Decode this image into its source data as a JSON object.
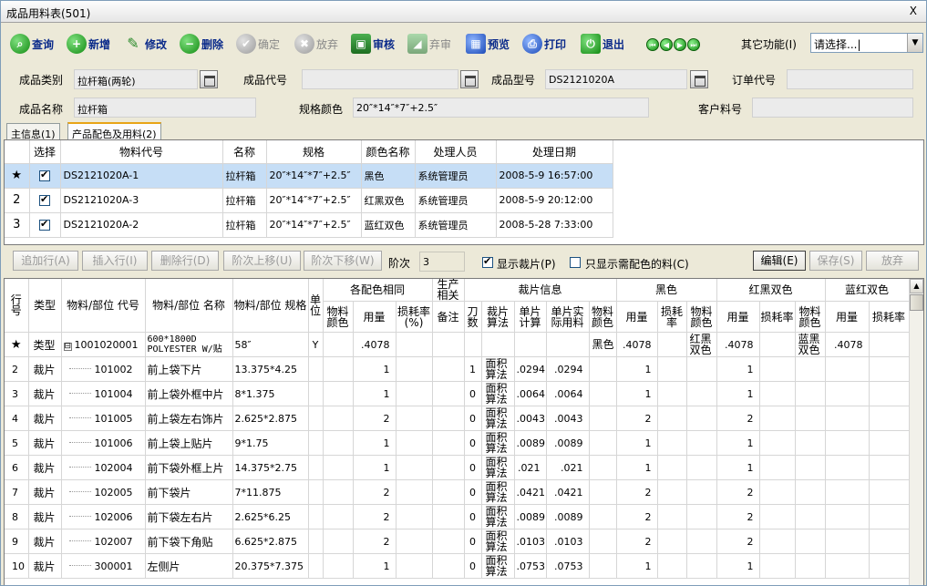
{
  "window": {
    "title": "成品用料表(501)",
    "close": "X"
  },
  "toolbar": {
    "query": "查询",
    "add": "新增",
    "edit": "修改",
    "delete": "删除",
    "confirm": "确定",
    "abandon": "放弃",
    "approve": "审核",
    "unapprove": "弃审",
    "preview": "预览",
    "print": "打印",
    "exit": "退出",
    "other_label": "其它功能(I)",
    "other_value": "请选择...|"
  },
  "header": {
    "category_label": "成品类别",
    "category_value": "拉杆箱(两轮)",
    "code_label": "成品代号",
    "code_value": "",
    "model_label": "成品型号",
    "model_value": "DS2121020A",
    "order_label": "订单代号",
    "order_value": "",
    "name_label": "成品名称",
    "name_value": "拉杆箱",
    "spec_label": "规格颜色",
    "spec_value": "20″*14″*7″+2.5″",
    "customer_label": "客户料号",
    "customer_value": ""
  },
  "tabs": [
    {
      "label": "主信息(1)"
    },
    {
      "label": "产品配色及用料(2)"
    }
  ],
  "color_grid": {
    "headers": [
      "选择",
      "物料代号",
      "名称",
      "规格",
      "颜色名称",
      "处理人员",
      "处理日期"
    ],
    "rows": [
      {
        "marker": "★",
        "checked": true,
        "code": "DS2121020A-1",
        "name": "拉杆箱",
        "spec": "20″*14″*7″+2.5″",
        "color": "黑色",
        "user": "系统管理员",
        "date": "2008-5-9 16:57:00"
      },
      {
        "marker": "2",
        "checked": true,
        "code": "DS2121020A-3",
        "name": "拉杆箱",
        "spec": "20″*14″*7″+2.5″",
        "color": "红黑双色",
        "user": "系统管理员",
        "date": "2008-5-9 20:12:00"
      },
      {
        "marker": "3",
        "checked": true,
        "code": "DS2121020A-2",
        "name": "拉杆箱",
        "spec": "20″*14″*7″+2.5″",
        "color": "蓝红双色",
        "user": "系统管理员",
        "date": "2008-5-28 7:33:00"
      }
    ]
  },
  "actions": {
    "append_row": "追加行(A)",
    "insert_row": "插入行(I)",
    "delete_row": "删除行(D)",
    "move_up": "阶次上移(U)",
    "move_down": "阶次下移(W)",
    "level_label": "阶次",
    "level_value": "3",
    "show_cut_label": "显示裁片(P)",
    "show_cut_checked": true,
    "only_color_label": "只显示需配色的料(C)",
    "only_color_checked": false,
    "edit": "编辑(E)",
    "save": "保存(S)",
    "abandon": "放弃"
  },
  "bom_grid": {
    "headers": {
      "row_no": "行号",
      "type": "类型",
      "part_code": "物料/部位 代号",
      "part_name": "物料/部位 名称",
      "part_spec": "物料/部位 规格",
      "unit": "单位",
      "common_group": "各配色相同",
      "mat_color": "物料颜色",
      "qty": "用量",
      "loss": "损耗率(%)",
      "prod_group": "生产相关",
      "remark": "备注",
      "cut_group": "裁片信息",
      "knife": "刀数",
      "cut_algo": "裁片算法",
      "unit_calc": "单片计算",
      "unit_actual": "单片实际用料",
      "black_group": "黑色",
      "rb_group": "红黑双色",
      "br_group": "蓝红双色",
      "c_mat_color": "物料颜色",
      "c_qty": "用量",
      "c_loss": "损耗率"
    },
    "rows": [
      {
        "no": "★",
        "type": "类型",
        "tree": "⊟",
        "code": "1001020001",
        "name": "600*1800D POLYESTER W/贴",
        "spec": "58″",
        "unit": "Y",
        "qty": ".4078",
        "loss": "",
        "remark": "",
        "knife": "",
        "algo": "",
        "calc": "",
        "actual": "",
        "c1": "黑色",
        "q1": ".4078",
        "c2": "红黑双色",
        "q2": ".4078",
        "c3": "蓝黑双色",
        "q3": ".4078"
      },
      {
        "no": "2",
        "type": "裁片",
        "code": "101002",
        "name": "前上袋下片",
        "spec": "13.375*4.25",
        "unit": "",
        "qty": "1",
        "knife": "1",
        "algo": "面积算法",
        "calc": ".0294",
        "actual": ".0294",
        "c1": "",
        "q1": "1",
        "c2": "",
        "q2": "1",
        "c3": "",
        "q3": ""
      },
      {
        "no": "3",
        "type": "裁片",
        "code": "101004",
        "name": "前上袋外框中片",
        "spec": "8*1.375",
        "unit": "",
        "qty": "1",
        "knife": "0",
        "algo": "面积算法",
        "calc": ".0064",
        "actual": ".0064",
        "c1": "",
        "q1": "1",
        "c2": "",
        "q2": "1",
        "c3": "",
        "q3": ""
      },
      {
        "no": "4",
        "type": "裁片",
        "code": "101005",
        "name": "前上袋左右饰片",
        "spec": "2.625*2.875",
        "unit": "",
        "qty": "2",
        "knife": "0",
        "algo": "面积算法",
        "calc": ".0043",
        "actual": ".0043",
        "c1": "",
        "q1": "2",
        "c2": "",
        "q2": "2",
        "c3": "",
        "q3": ""
      },
      {
        "no": "5",
        "type": "裁片",
        "code": "101006",
        "name": "前上袋上贴片",
        "spec": "9*1.75",
        "unit": "",
        "qty": "1",
        "knife": "0",
        "algo": "面积算法",
        "calc": ".0089",
        "actual": ".0089",
        "c1": "",
        "q1": "1",
        "c2": "",
        "q2": "1",
        "c3": "",
        "q3": ""
      },
      {
        "no": "6",
        "type": "裁片",
        "code": "102004",
        "name": "前下袋外框上片",
        "spec": "14.375*2.75",
        "unit": "",
        "qty": "1",
        "knife": "0",
        "algo": "面积算法",
        "calc": ".021",
        "actual": ".021",
        "c1": "",
        "q1": "1",
        "c2": "",
        "q2": "1",
        "c3": "",
        "q3": ""
      },
      {
        "no": "7",
        "type": "裁片",
        "code": "102005",
        "name": "前下袋片",
        "spec": "7*11.875",
        "unit": "",
        "qty": "2",
        "knife": "0",
        "algo": "面积算法",
        "calc": ".0421",
        "actual": ".0421",
        "c1": "",
        "q1": "2",
        "c2": "",
        "q2": "2",
        "c3": "",
        "q3": ""
      },
      {
        "no": "8",
        "type": "裁片",
        "code": "102006",
        "name": "前下袋左右片",
        "spec": "2.625*6.25",
        "unit": "",
        "qty": "2",
        "knife": "0",
        "algo": "面积算法",
        "calc": ".0089",
        "actual": ".0089",
        "c1": "",
        "q1": "2",
        "c2": "",
        "q2": "2",
        "c3": "",
        "q3": ""
      },
      {
        "no": "9",
        "type": "裁片",
        "code": "102007",
        "name": "前下袋下角贴",
        "spec": "6.625*2.875",
        "unit": "",
        "qty": "2",
        "knife": "0",
        "algo": "面积算法",
        "calc": ".0103",
        "actual": ".0103",
        "c1": "",
        "q1": "2",
        "c2": "",
        "q2": "2",
        "c3": "",
        "q3": ""
      },
      {
        "no": "10",
        "type": "裁片",
        "code": "300001",
        "name": "左侧片",
        "spec": "20.375*7.375",
        "unit": "",
        "qty": "1",
        "knife": "0",
        "algo": "面积算法",
        "calc": ".0753",
        "actual": ".0753",
        "c1": "",
        "q1": "1",
        "c2": "",
        "q2": "1",
        "c3": "",
        "q3": ""
      }
    ]
  }
}
